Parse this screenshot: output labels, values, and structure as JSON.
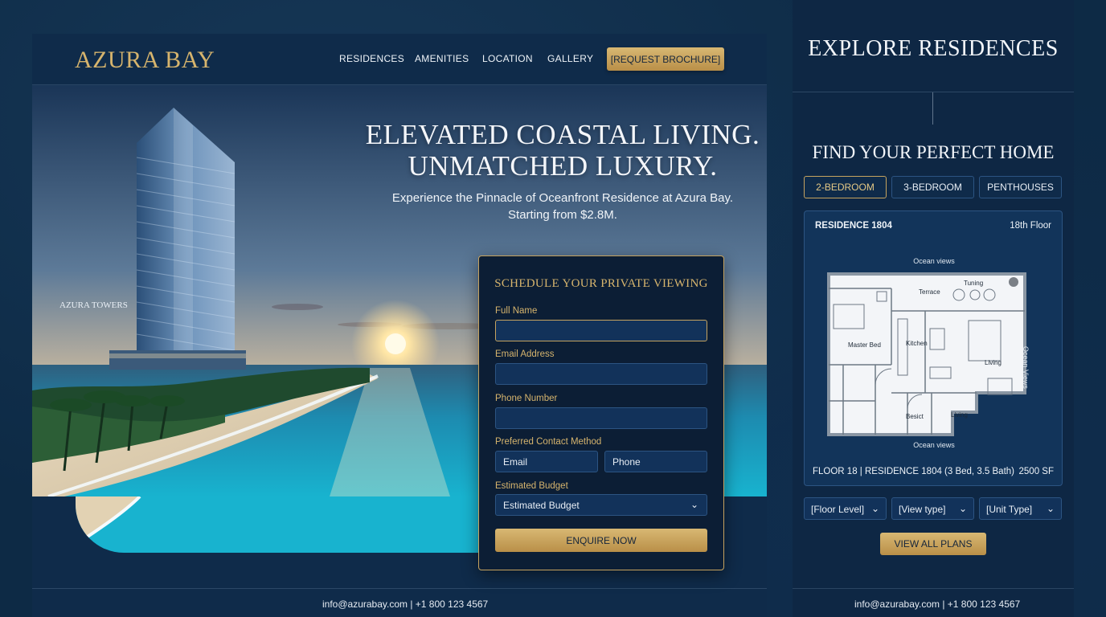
{
  "brand": {
    "logo": "AZURA BAY"
  },
  "nav": {
    "items": [
      {
        "label": "RESIDENCES"
      },
      {
        "label": "AMENITIES"
      },
      {
        "label": "LOCATION"
      },
      {
        "label": "GALLERY"
      }
    ],
    "cta_label": "[REQUEST BROCHURE]"
  },
  "hero": {
    "headline_line1": "ELEVATED COASTAL LIVING.",
    "headline_line2": "UNMATCHED LUXURY.",
    "sub_line1": "Experience the Pinnacle of Oceanfront Residence at Azura Bay.",
    "sub_line2": "Starting from $2.8M.",
    "tower_label": "AZURA TOWERS"
  },
  "form": {
    "title": "SCHEDULE YOUR PRIVATE VIEWING",
    "full_name_label": "Full Name",
    "full_name_value": "",
    "email_label": "Email Address",
    "email_value": "",
    "phone_label": "Phone Number",
    "phone_value": "",
    "contact_method_label": "Preferred Contact Method",
    "contact_options": [
      "Email",
      "Phone"
    ],
    "budget_label": "Estimated Budget",
    "budget_selected": "Estimated Budget",
    "submit_label": "ENQUIRE NOW"
  },
  "footer": {
    "main_contact": "info@azurabay.com | +1 800 123 4567",
    "side_contact": "info@azurabay.com | +1 800 123 4567"
  },
  "side": {
    "title": "EXPLORE RESIDENCES",
    "subtitle": "FIND YOUR PERFECT HOME",
    "tabs": [
      {
        "label": "2-BEDROOM",
        "active": true
      },
      {
        "label": "3-BEDROOM",
        "active": false
      },
      {
        "label": "PENTHOUSES",
        "active": false
      }
    ],
    "plan": {
      "residence": "RESIDENCE 1804",
      "floor": "18th Floor",
      "ocean_top": "Ocean views",
      "ocean_bottom": "Ocean views",
      "ocean_side": "Ocean Views",
      "rooms": {
        "terrace": "Terrace",
        "dining": "Tuning",
        "master": "Master Bed",
        "kitchen": "Kitchen",
        "living1": "Living",
        "bed2": "Besict",
        "living2": "Living"
      },
      "summary": "FLOOR 18 | RESIDENCE 1804 (3 Bed, 3.5 Bath)",
      "area": "2500 SF"
    },
    "filters": [
      {
        "label": "[Floor Level]"
      },
      {
        "label": "[View type]"
      },
      {
        "label": "[Unit Type]"
      }
    ],
    "view_all_label": "VIEW ALL PLANS"
  },
  "colors": {
    "gold": "#d6b46d",
    "navy": "#0f2b4a",
    "deep_navy": "#0c1e35"
  }
}
